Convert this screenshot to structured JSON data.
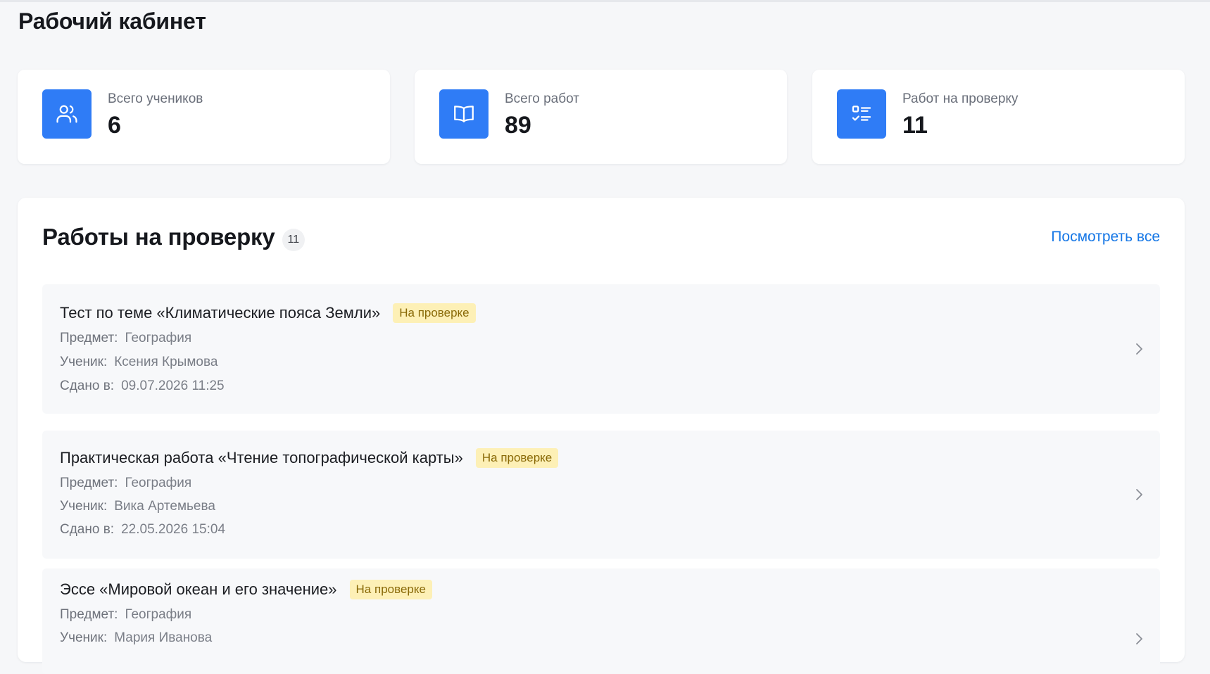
{
  "page": {
    "title": "Рабочий кабинет"
  },
  "stats": [
    {
      "icon": "users-icon",
      "label": "Всего учеников",
      "value": "6"
    },
    {
      "icon": "book-open-icon",
      "label": "Всего работ",
      "value": "89"
    },
    {
      "icon": "checklist-icon",
      "label": "Работ на проверку",
      "value": "11"
    }
  ],
  "review": {
    "title": "Работы на проверку",
    "count": "11",
    "view_all": "Посмотреть все",
    "labels": {
      "subject": "Предмет:",
      "student": "Ученик:",
      "submitted": "Сдано в:"
    },
    "items": [
      {
        "title": "Тест по теме «Климатические пояса Земли»",
        "status": "На проверке",
        "subject": "География",
        "student": "Ксения Крымова",
        "submitted": "09.07.2026 11:25"
      },
      {
        "title": "Практическая работа «Чтение топографической карты»",
        "status": "На проверке",
        "subject": "География",
        "student": "Вика Артемьева",
        "submitted": "22.05.2026 15:04"
      },
      {
        "title": "Эссе «Мировой океан и его значение»",
        "status": "На проверке",
        "subject": "География",
        "student": "Мария Иванова"
      }
    ]
  },
  "colors": {
    "accent": "#2f7cf6",
    "link": "#1677e6",
    "status_bg": "#fdf0b6",
    "status_text": "#8a6a08"
  }
}
